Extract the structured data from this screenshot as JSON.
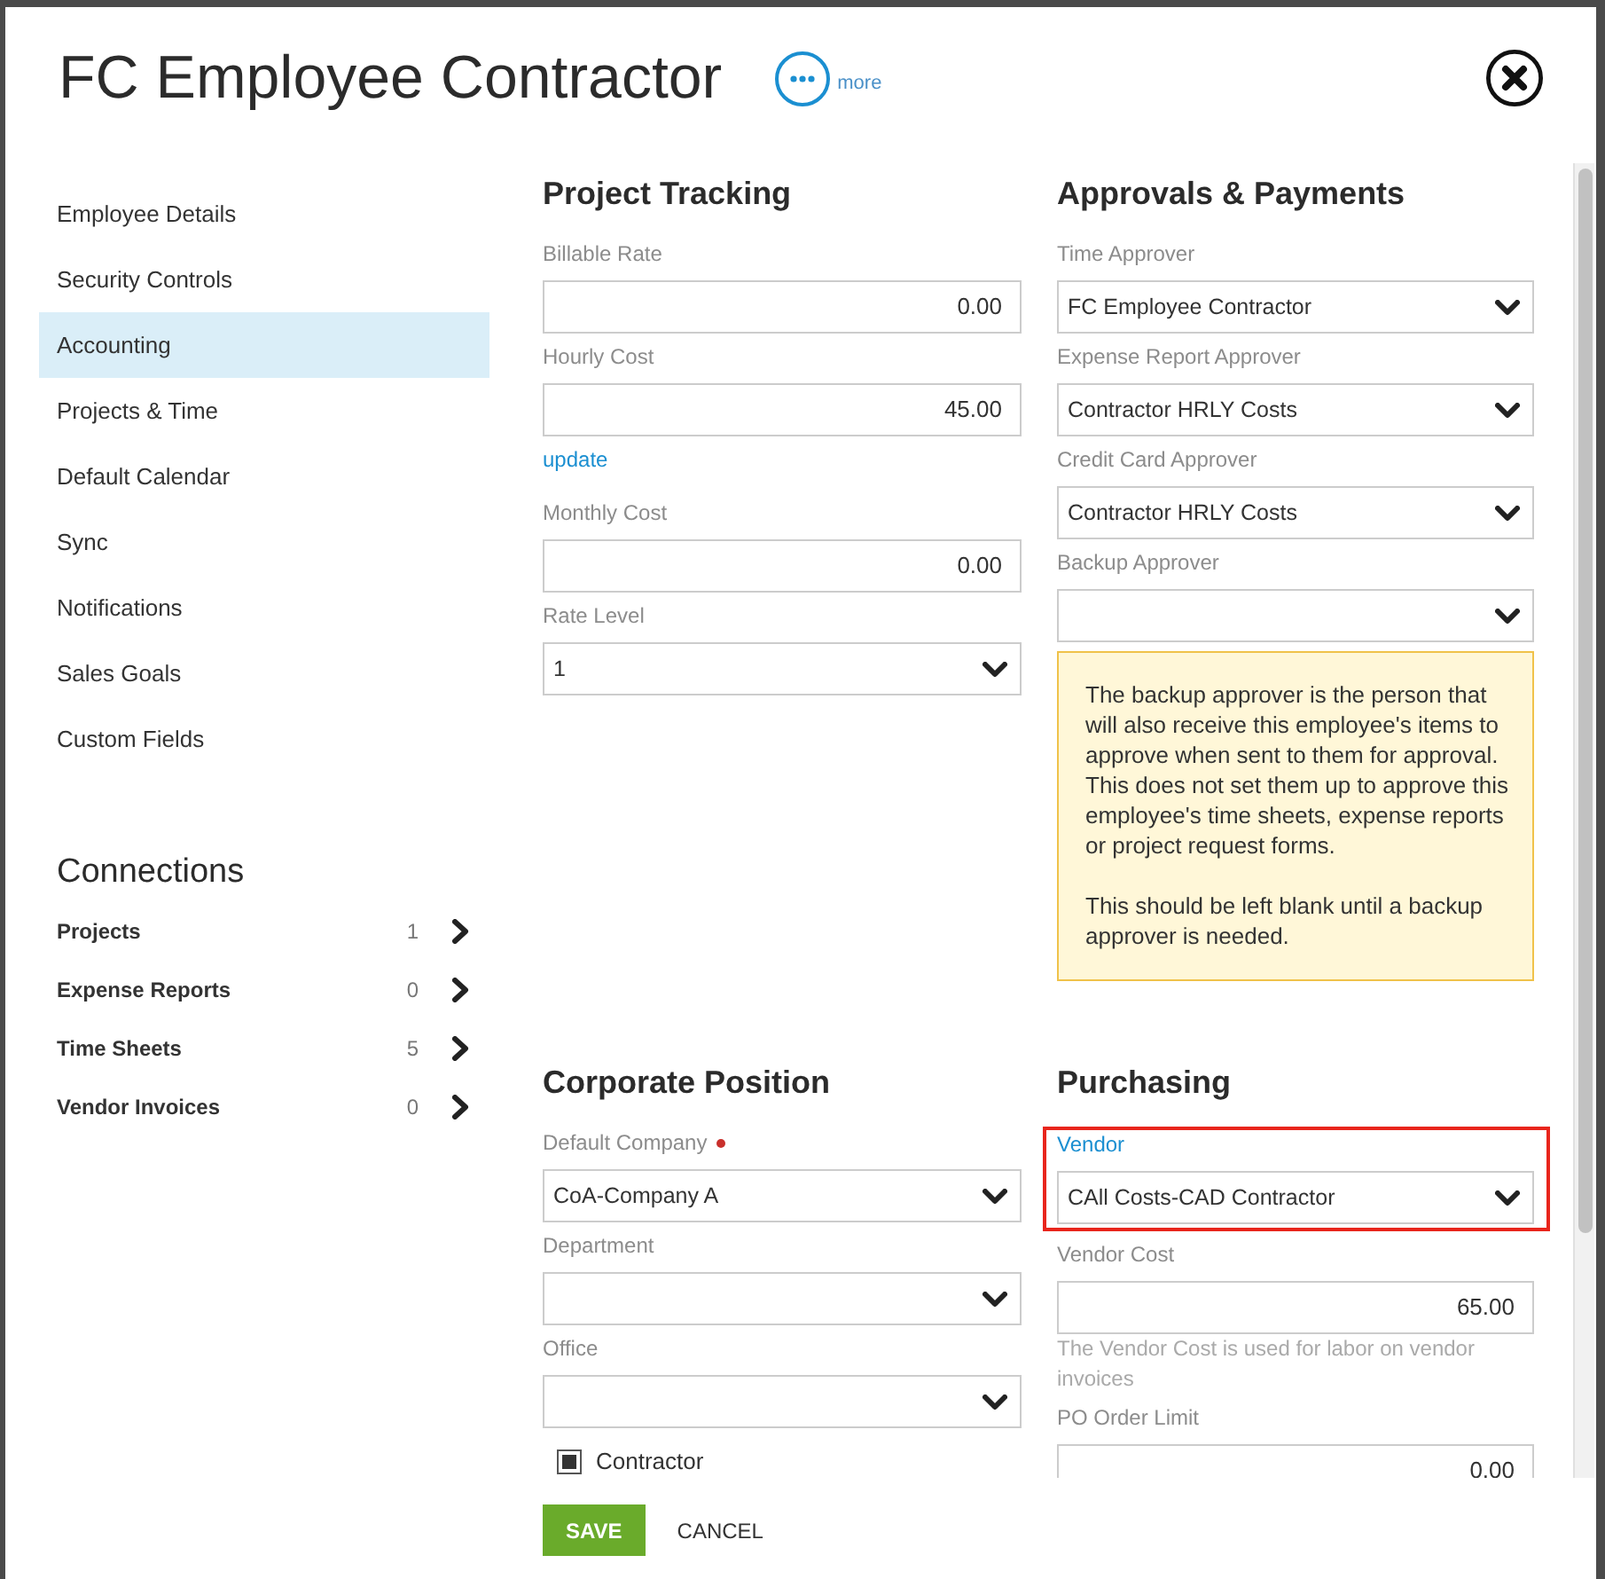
{
  "window": {
    "title": "FC Employee Contractor",
    "more_link": "more"
  },
  "sidebar": {
    "items": [
      {
        "label": "Employee Details",
        "selected": false
      },
      {
        "label": "Security Controls",
        "selected": false
      },
      {
        "label": "Accounting",
        "selected": true
      },
      {
        "label": "Projects & Time",
        "selected": false
      },
      {
        "label": "Default Calendar",
        "selected": false
      },
      {
        "label": "Sync",
        "selected": false
      },
      {
        "label": "Notifications",
        "selected": false
      },
      {
        "label": "Sales Goals",
        "selected": false
      },
      {
        "label": "Custom Fields",
        "selected": false
      }
    ]
  },
  "connections": {
    "title": "Connections",
    "items": [
      {
        "label": "Projects",
        "count": "1"
      },
      {
        "label": "Expense Reports",
        "count": "0"
      },
      {
        "label": "Time Sheets",
        "count": "5"
      },
      {
        "label": "Vendor Invoices",
        "count": "0"
      }
    ]
  },
  "sections": [
    {
      "title": "Project Tracking",
      "fields": [
        {
          "kind": "number",
          "label": "Billable Rate",
          "value": "0.00",
          "required": false,
          "highlighted": false
        },
        {
          "kind": "number",
          "label": "Hourly Cost",
          "value": "45.00",
          "required": false,
          "highlighted": false
        },
        {
          "kind": "link",
          "label": "update"
        },
        {
          "kind": "number",
          "label": "Monthly Cost",
          "value": "0.00",
          "required": false,
          "highlighted": false
        },
        {
          "kind": "select",
          "label": "Rate Level",
          "value": "1",
          "required": false,
          "highlighted": false
        }
      ]
    },
    {
      "title": "Approvals & Payments",
      "fields": [
        {
          "kind": "select",
          "label": "Time Approver",
          "value": "FC Employee Contractor",
          "required": false,
          "highlighted": false
        },
        {
          "kind": "select",
          "label": "Expense Report Approver",
          "value": "Contractor HRLY Costs",
          "required": false,
          "highlighted": false
        },
        {
          "kind": "select",
          "label": "Credit Card Approver",
          "value": "Contractor HRLY Costs",
          "required": false,
          "highlighted": false
        },
        {
          "kind": "select",
          "label": "Backup Approver",
          "required": false,
          "highlighted": false
        },
        {
          "kind": "note",
          "paragraphs": [
            "The backup approver is the person that will also receive this employee's items to approve when sent to them for approval. This does not set them up to approve this employee's time sheets, expense reports or project request forms.",
            "This should be left blank until a backup approver is needed."
          ]
        }
      ]
    },
    {
      "title": "Corporate Position",
      "fields": [
        {
          "kind": "select",
          "label": "Default Company",
          "value": "CoA-Company A",
          "required": true,
          "highlighted": false
        },
        {
          "kind": "select",
          "label": "Department",
          "required": false,
          "highlighted": false
        },
        {
          "kind": "select",
          "label": "Office",
          "required": false,
          "highlighted": false
        },
        {
          "kind": "checkbox",
          "label": "Contractor",
          "checked": true
        }
      ]
    },
    {
      "title": "Purchasing",
      "fields": [
        {
          "kind": "select",
          "label": "Vendor",
          "value": "CAll Costs-CAD Contractor",
          "required": false,
          "highlighted": true
        },
        {
          "kind": "number",
          "label": "Vendor Cost",
          "value": "65.00",
          "help": "The Vendor Cost is used for labor on vendor invoices",
          "required": false,
          "highlighted": false
        },
        {
          "kind": "number",
          "label": "PO Order Limit",
          "value": "0.00",
          "required": false,
          "highlighted": false
        }
      ]
    }
  ],
  "footer": {
    "buttons": [
      {
        "kind": "primary",
        "label": "SAVE"
      },
      {
        "kind": "plain",
        "label": "CANCEL"
      }
    ]
  }
}
